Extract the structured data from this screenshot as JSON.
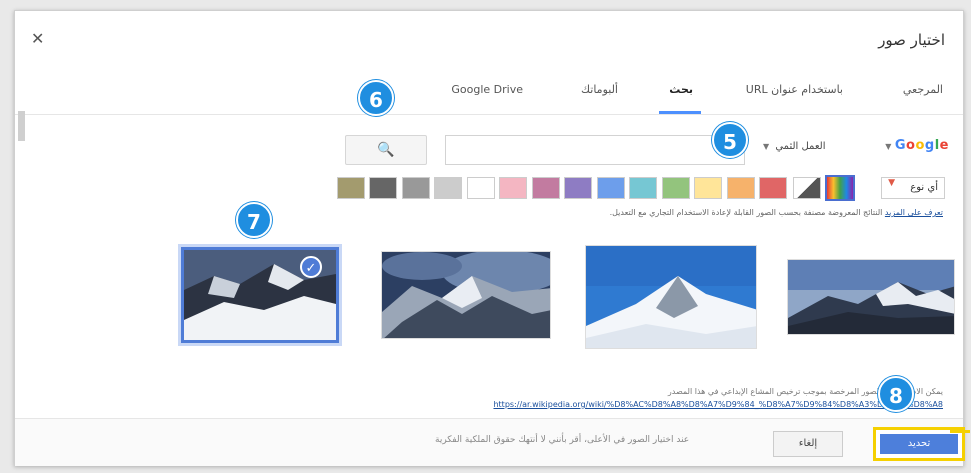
{
  "dialog": {
    "title": "اختيار صور",
    "close_icon": "close-icon"
  },
  "tabs": [
    {
      "label": "المرجعي",
      "active": false
    },
    {
      "label": "باستخدام عنوان URL",
      "active": false
    },
    {
      "label": "بحث",
      "active": true
    },
    {
      "label": "ألبوماتك",
      "active": false
    },
    {
      "label": "Google Drive",
      "active": false
    }
  ],
  "search": {
    "google_label": "Google",
    "license_filter": "العمل الثمي",
    "input_value": "",
    "button_icon": "search-icon"
  },
  "filters": {
    "type_label": "أي نوع",
    "colors": [
      "#e06666",
      "#f6b26b",
      "#ffe599",
      "#93c47d",
      "#76c7d3",
      "#6d9eeb",
      "#8e7cc3",
      "#c27ba0",
      "#f4b6c2",
      "#ffffff",
      "#cccccc",
      "#999999",
      "#666666",
      "#a39b6e"
    ]
  },
  "notice": {
    "text": "النتائج المعروضة مصنفة بحسب الصور القابلة لإعادة الاستخدام التجاري مع التعديل.",
    "link": "تعرف على المزيد"
  },
  "images": [
    {
      "name": "mountain-1",
      "selected": false
    },
    {
      "name": "mountain-2",
      "selected": false
    },
    {
      "name": "mountain-3",
      "selected": false
    },
    {
      "name": "mountain-4",
      "selected": true
    }
  ],
  "source": {
    "caption": "يمكن الاطلاع على الصور المرخصة بموجب ترخيص المشاع الإبداعي في هذا المصدر",
    "url": "https://ar.wikipedia.org/wiki/%D8%AC%D8%A8%D8%A7%D9%84_%D8%A7%D9%84%D8%A3%D9%84%D8%A8"
  },
  "footer": {
    "note": "عند اختيار الصور في الأعلى، أقر بأنني لا أنتهك حقوق الملكية الفكرية",
    "cancel_label": "إلغاء",
    "select_label": "تحديد"
  },
  "callouts": [
    "5",
    "6",
    "7",
    "8"
  ],
  "accent": {
    "badge": "#1f8ee0",
    "highlight": "#f5d000",
    "selected": "#4f7cd6"
  }
}
